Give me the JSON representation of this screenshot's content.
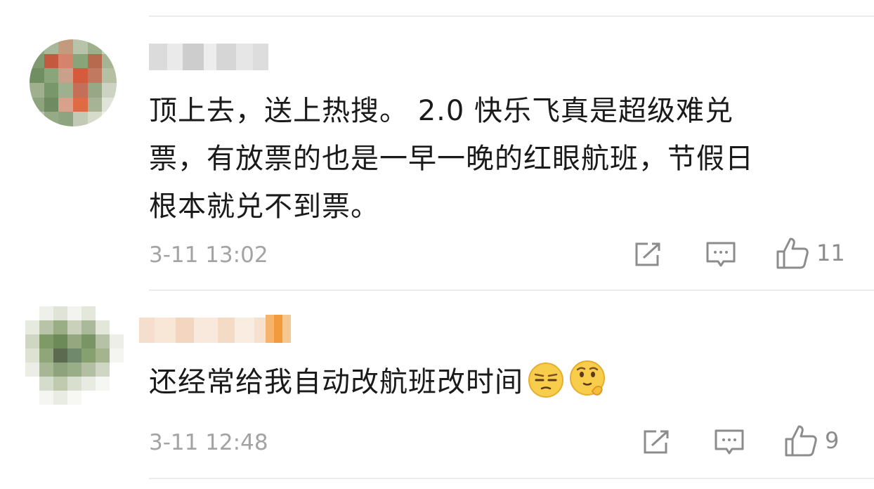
{
  "comments": [
    {
      "username": "",
      "text": "顶上去，送上热搜。 2.0 快乐飞真是超级难兑票，有放票的也是一早一晚的红眼航班，节假日根本就兑不到票。",
      "lines": [
        "顶上去，送上热搜。 2.0 快乐飞真是超级难兑",
        "票，有放票的也是一早一晚的红眼航班，节假日",
        "根本就兑不到票。"
      ],
      "time": "3-11 13:02",
      "likes": "11",
      "icons": [
        "share-icon",
        "comment-icon",
        "thumbs-up-icon"
      ]
    },
    {
      "username": "",
      "text": "还经常给我自动改航班改时间",
      "emojis": [
        "unamused-emoji",
        "thinking-emoji"
      ],
      "time": "3-11 12:48",
      "likes": "9",
      "icons": [
        "share-icon",
        "comment-icon",
        "thumbs-up-icon"
      ]
    }
  ],
  "colors": {
    "text": "#1a1a1a",
    "meta": "#a3a3a3",
    "icon": "#8c8c8c",
    "divider": "#ececec"
  }
}
